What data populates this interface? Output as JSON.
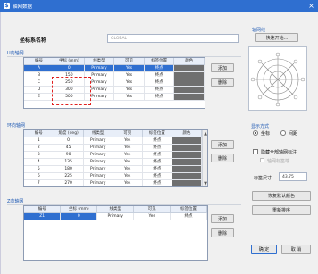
{
  "window": {
    "title": "轴网数据",
    "close_label": "×"
  },
  "coord": {
    "label": "坐标系名称",
    "value": "GLOBAL"
  },
  "x_grid": {
    "section_label": "U向轴网",
    "columns": [
      "编号",
      "坐标 (mm)",
      "线类型",
      "可见",
      "标签位置",
      "颜色"
    ],
    "rows": [
      {
        "id": "A",
        "coord": "0",
        "line": "Primary",
        "visible": "Yes",
        "label_pos": "终点",
        "selected": true
      },
      {
        "id": "B",
        "coord": "150",
        "line": "Primary",
        "visible": "Yes",
        "label_pos": "终点"
      },
      {
        "id": "C",
        "coord": "250",
        "line": "Primary",
        "visible": "Yes",
        "label_pos": "终点"
      },
      {
        "id": "D",
        "coord": "300",
        "line": "Primary",
        "visible": "Yes",
        "label_pos": "终点"
      },
      {
        "id": "E",
        "coord": "500",
        "line": "Primary",
        "visible": "Yes",
        "label_pos": "终点"
      }
    ],
    "add_label": "添加",
    "delete_label": "删除"
  },
  "angle_grid": {
    "section_label": "环向轴网",
    "columns": [
      "编号",
      "角度 (deg)",
      "线类型",
      "可见",
      "标签位置",
      "颜色"
    ],
    "rows": [
      {
        "id": "1",
        "coord": "0",
        "line": "Primary",
        "visible": "Yes",
        "label_pos": "终点"
      },
      {
        "id": "2",
        "coord": "45",
        "line": "Primary",
        "visible": "Yes",
        "label_pos": "终点"
      },
      {
        "id": "3",
        "coord": "90",
        "line": "Primary",
        "visible": "Yes",
        "label_pos": "终点"
      },
      {
        "id": "4",
        "coord": "135",
        "line": "Primary",
        "visible": "Yes",
        "label_pos": "终点"
      },
      {
        "id": "5",
        "coord": "180",
        "line": "Primary",
        "visible": "Yes",
        "label_pos": "终点"
      },
      {
        "id": "6",
        "coord": "225",
        "line": "Primary",
        "visible": "Yes",
        "label_pos": "终点"
      },
      {
        "id": "7",
        "coord": "270",
        "line": "Primary",
        "visible": "Yes",
        "label_pos": "终点"
      }
    ],
    "add_label": "添加",
    "delete_label": "删除"
  },
  "z_grid": {
    "section_label": "Z向轴网",
    "columns": [
      "编号",
      "坐标 (mm)",
      "线类型",
      "可见",
      "标签位置"
    ],
    "rows": [
      {
        "id": "Z1",
        "coord": "0",
        "line": "Primary",
        "visible": "Yes",
        "label_pos": "终点"
      }
    ],
    "add_label": "添加",
    "delete_label": "删除"
  },
  "preview": {
    "section_label": "轴网线",
    "quick_start_label": "快速开始..."
  },
  "display": {
    "section_label": "显示方式",
    "option_ordinate": "坐标",
    "option_spacing": "间距",
    "bubble_checkbox": "隐藏全部轴网标注",
    "sub_checkbox": "轴网标签端",
    "bubble_size_label": "标签尺寸",
    "bubble_size_value": "43.75",
    "reset_color_label": "恢复默认颜色",
    "reorder_label": "重新排序"
  },
  "footer": {
    "ok_label": "确 定",
    "cancel_label": "取 消"
  },
  "colors": {
    "title_bar": "#2f6fd0",
    "selection": "#2f6fd0",
    "swatch": "#6f6f6f",
    "highlight_box": "#e02020"
  }
}
